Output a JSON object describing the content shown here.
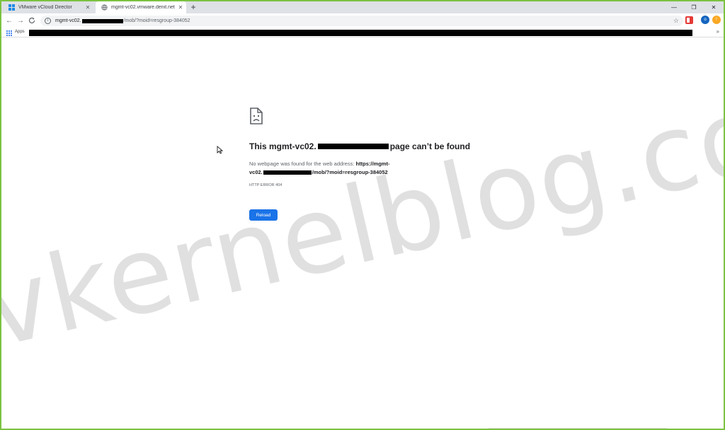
{
  "tabs": [
    {
      "title": "VMware vCloud Director",
      "active": false,
      "icon": "vmware-icon"
    },
    {
      "title": "mgmt-vc02.vmware.denit.net",
      "active": true,
      "icon": "globe-icon"
    }
  ],
  "window_controls": {
    "minimize": "—",
    "restore": "❐",
    "close": "✕"
  },
  "toolbar": {
    "back": "←",
    "forward": "→",
    "reload": "C",
    "url_prefix": "mgmt-vc02.",
    "url_suffix": "/mob/?moid=resgroup-384052",
    "profile_initial": "o",
    "menu": "!"
  },
  "bookmarks": {
    "apps_label": "Apps",
    "overflow": "»"
  },
  "error_page": {
    "title_prefix": "This mgmt-vc02.",
    "title_suffix": "page can’t be found",
    "desc_text": "No webpage was found for the web address:",
    "desc_url_start": "https://mgmt-",
    "desc_url_mid": "vc02.",
    "desc_url_end": "/mob/?moid=resgroup-384052",
    "error_code": "HTTP ERROR 404",
    "reload_label": "Reload"
  },
  "watermark": "vkernelblog.com",
  "colors": {
    "border": "#7cc242",
    "accent": "#1a73e8",
    "tabstrip": "#dee1e6"
  }
}
